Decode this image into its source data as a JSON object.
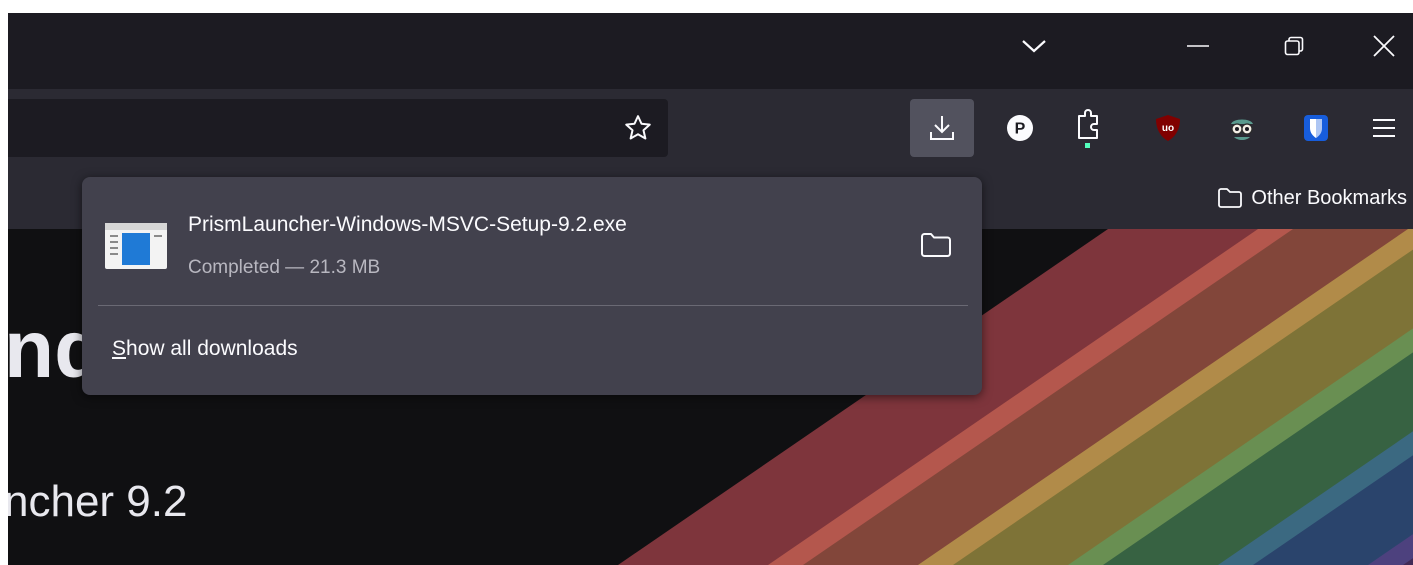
{
  "titlebar": {
    "list_all_tabs_icon": "chevron-down-icon",
    "minimize_icon": "minimize-icon",
    "restore_icon": "restore-icon",
    "close_icon": "close-icon"
  },
  "toolbar": {
    "bookmark_star_icon": "star-outline-icon",
    "items": [
      {
        "name": "downloads",
        "icon": "download-arrow-icon",
        "active": true
      },
      {
        "name": "p-extension",
        "icon": "circle-p-icon"
      },
      {
        "name": "extensions",
        "icon": "puzzle-piece-icon",
        "badge_color": "#54ffbd"
      },
      {
        "name": "ublock-origin",
        "icon": "ublock-shield-icon",
        "color": "#800000"
      },
      {
        "name": "extension-eyes",
        "icon": "spy-face-icon"
      },
      {
        "name": "bitwarden",
        "icon": "bitwarden-shield-icon",
        "color": "#175ddc"
      },
      {
        "name": "menu",
        "icon": "hamburger-menu-icon"
      }
    ]
  },
  "bookmarks": {
    "other_label": "Other Bookmarks",
    "other_icon": "folder-icon"
  },
  "page": {
    "heading_fragment": "nd",
    "subheading_fragment": "ncher 9.2",
    "stripe_colors": [
      "#d8545e",
      "#e0735b",
      "#d8c456",
      "#57a66a",
      "#3f6fb6",
      "#6a3f8e"
    ]
  },
  "downloads_panel": {
    "item": {
      "filename": "PrismLauncher-Windows-MSVC-Setup-9.2.exe",
      "status": "Completed — 21.3 MB",
      "icon": "windows-installer-icon",
      "action_icon": "folder-icon"
    },
    "show_all": {
      "mnemonic": "S",
      "rest": "how all downloads"
    }
  }
}
